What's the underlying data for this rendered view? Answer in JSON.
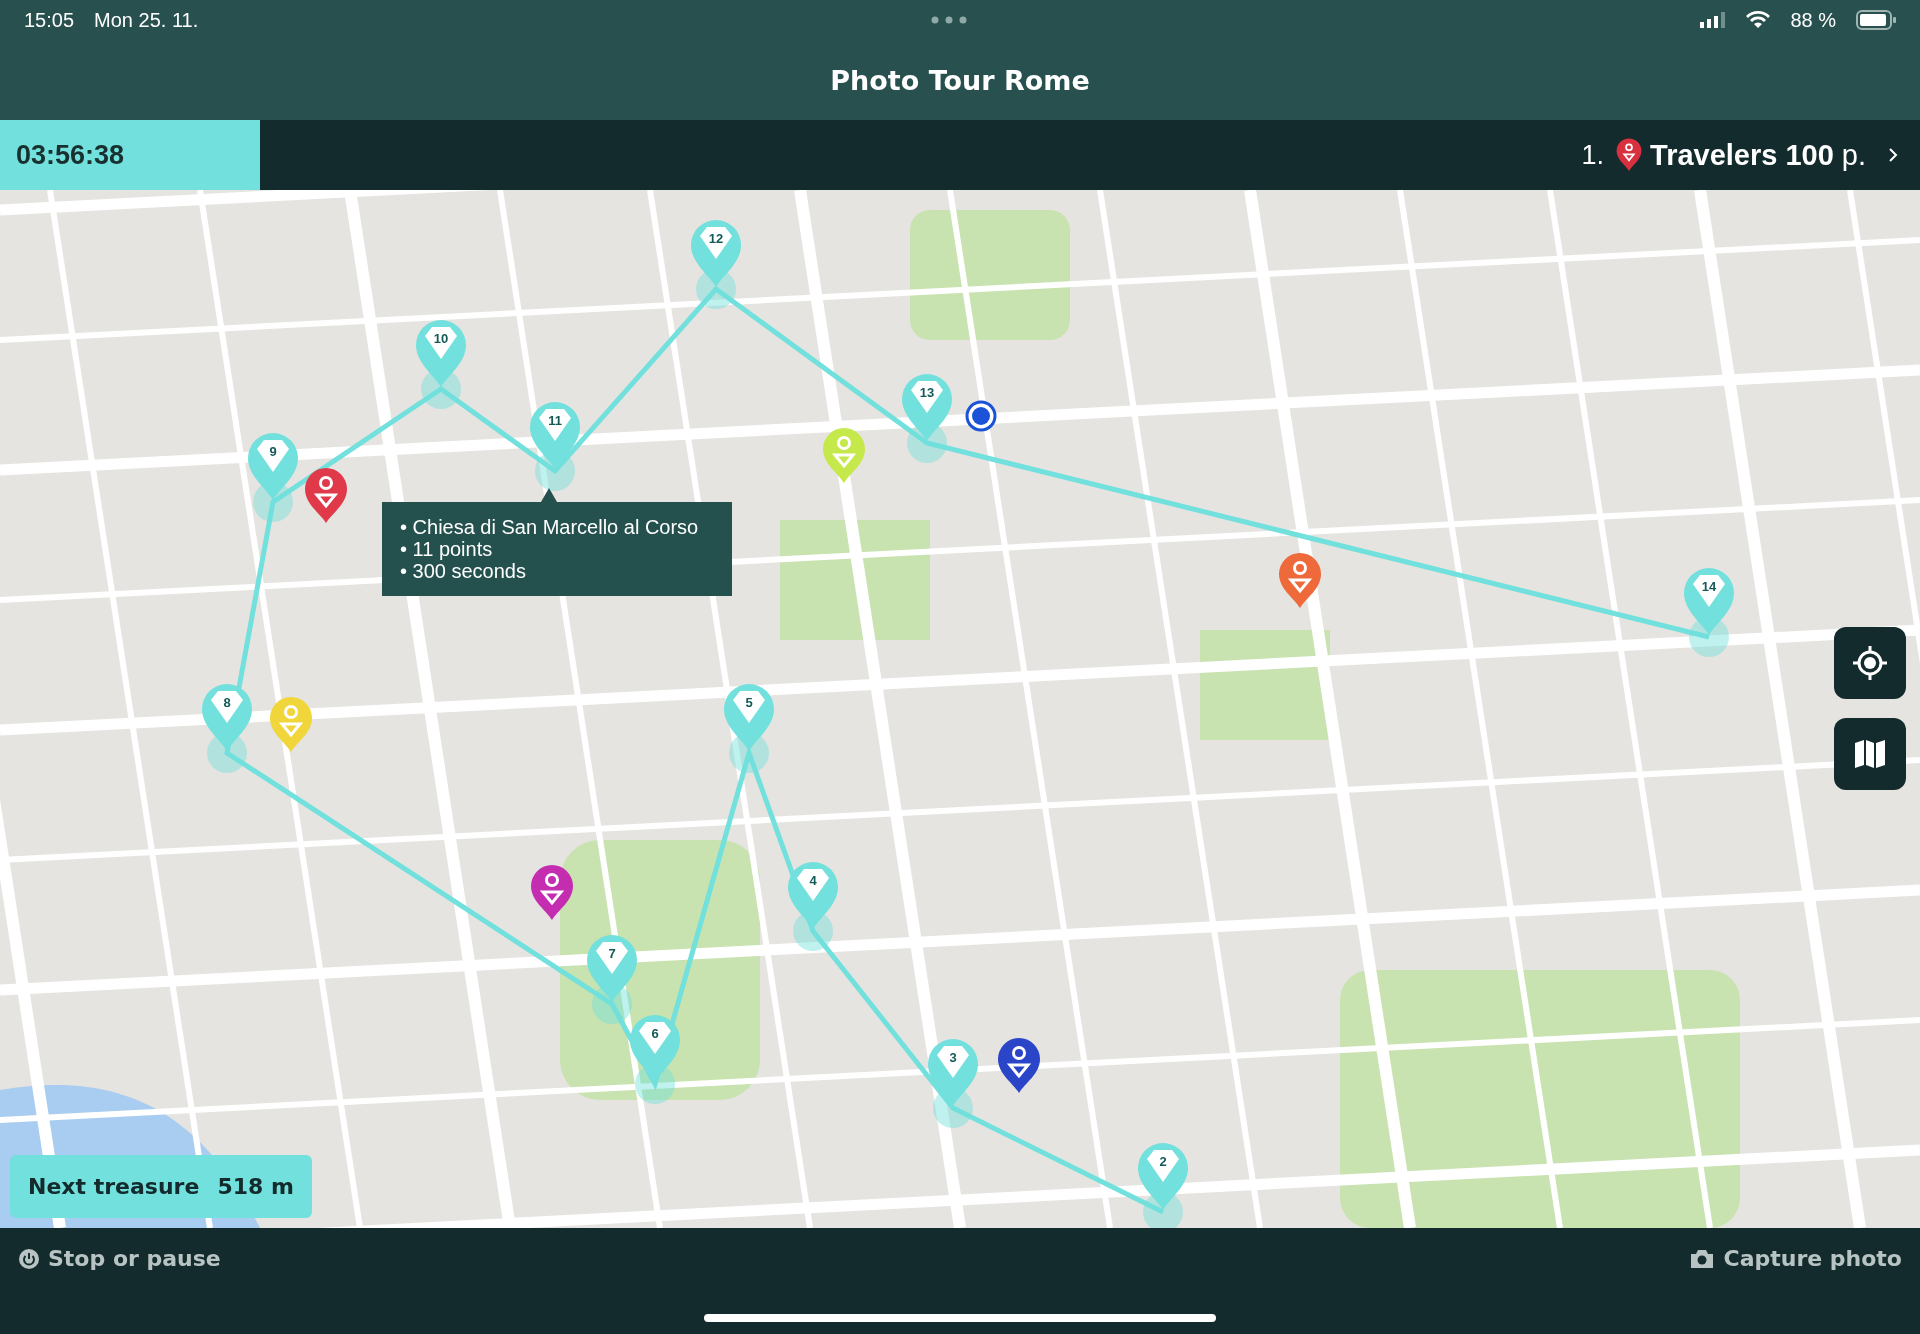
{
  "status_bar": {
    "time": "15:05",
    "date": "Mon 25. 11.",
    "battery": "88 %"
  },
  "title": "Photo Tour Rome",
  "score_bar": {
    "timer": "03:56:38",
    "rank": "1.",
    "team": "Travelers",
    "score": "100",
    "unit": "p."
  },
  "map": {
    "treasures": [
      {
        "label": "2"
      },
      {
        "label": "3"
      },
      {
        "label": "4"
      },
      {
        "label": "5"
      },
      {
        "label": "6"
      },
      {
        "label": "7"
      },
      {
        "label": "8"
      },
      {
        "label": "9"
      },
      {
        "label": "10"
      },
      {
        "label": "11"
      },
      {
        "label": "12"
      },
      {
        "label": "13"
      },
      {
        "label": "14"
      }
    ],
    "players": [
      {
        "color": "#e0394a"
      },
      {
        "color": "#c5e84a"
      },
      {
        "color": "#ef6a3a"
      },
      {
        "color": "#f0d63a"
      },
      {
        "color": "#c42db0"
      },
      {
        "color": "#2a45c8"
      }
    ],
    "tooltip": {
      "lines": [
        "• Chiesa di San Marcello al Corso",
        "• 11 points",
        "• 300 seconds"
      ]
    },
    "next_treasure": {
      "label": "Next treasure",
      "distance": "518 m"
    }
  },
  "bottom_bar": {
    "stop": "Stop or pause",
    "capture": "Capture photo"
  }
}
